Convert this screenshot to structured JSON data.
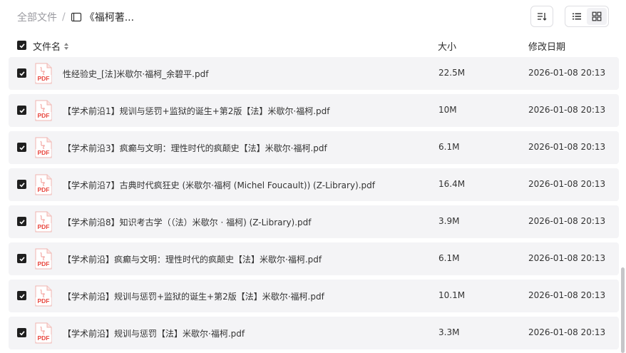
{
  "breadcrumb": {
    "root": "全部文件",
    "separator": "/",
    "current": "《福柯著..."
  },
  "icons": {
    "book": "book-icon",
    "sort": "sort-icon",
    "list_view": "list-view-icon",
    "grid_view": "grid-view-icon",
    "checkbox": "checkbox-checked-icon",
    "pdf": "pdf-file-icon"
  },
  "colors": {
    "row_background": "#f4f4f6",
    "checkbox": "#1f1f1f",
    "pdf_red": "#e8473f"
  },
  "table": {
    "columns": {
      "name": "文件名",
      "size": "大小",
      "modified": "修改日期"
    },
    "rows": [
      {
        "name": "性经验史_[法]米歇尔·福柯_余碧平.pdf",
        "size": "22.5M",
        "modified": "2026-01-08 20:13",
        "checked": true
      },
      {
        "name": "【学术前沿1】规训与惩罚+监狱的诞生+第2版【法】米歇尔·福柯.pdf",
        "size": "10M",
        "modified": "2026-01-08 20:13",
        "checked": true
      },
      {
        "name": "【学术前沿3】疯癫与文明：理性时代的疯颠史【法】米歇尔·福柯.pdf",
        "size": "6.1M",
        "modified": "2026-01-08 20:13",
        "checked": true
      },
      {
        "name": "【学术前沿7】古典时代疯狂史 (米歇尔·福柯 (Michel Foucault)) (Z-Library).pdf",
        "size": "16.4M",
        "modified": "2026-01-08 20:13",
        "checked": true
      },
      {
        "name": "【学术前沿8】知识考古学（（法）米歇尔 · 福柯) (Z-Library).pdf",
        "size": "3.9M",
        "modified": "2026-01-08 20:13",
        "checked": true
      },
      {
        "name": "【学术前沿】疯癫与文明：理性时代的疯颠史【法】米歇尔·福柯.pdf",
        "size": "6.1M",
        "modified": "2026-01-08 20:13",
        "checked": true
      },
      {
        "name": "【学术前沿】规训与惩罚+监狱的诞生+第2版【法】米歇尔·福柯.pdf",
        "size": "10.1M",
        "modified": "2026-01-08 20:13",
        "checked": true
      },
      {
        "name": "【学术前沿】规训与惩罚【法】米歇尔·福柯.pdf",
        "size": "3.3M",
        "modified": "2026-01-08 20:13",
        "checked": true
      }
    ]
  }
}
